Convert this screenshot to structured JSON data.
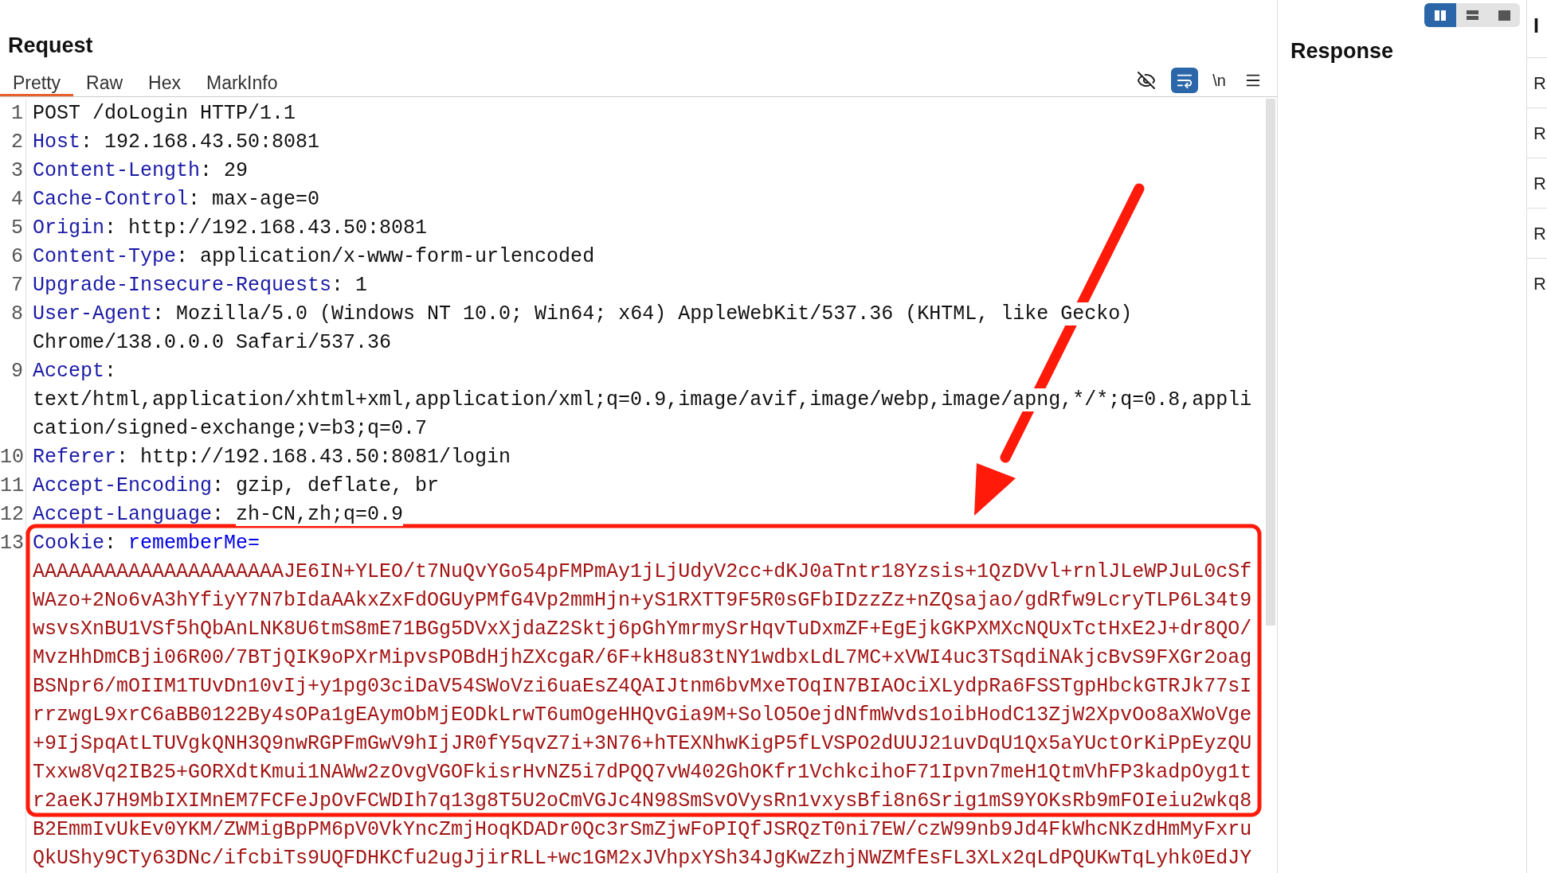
{
  "request": {
    "title": "Request",
    "tabs": [
      {
        "label": "Pretty",
        "selected": true
      },
      {
        "label": "Raw",
        "selected": false
      },
      {
        "label": "Hex",
        "selected": false
      },
      {
        "label": "MarkInfo",
        "selected": false
      }
    ],
    "toolbar": [
      {
        "kind": "hide",
        "selected": false
      },
      {
        "kind": "wrap",
        "selected": true
      },
      {
        "kind": "newline",
        "label": "\\n"
      },
      {
        "kind": "menu"
      }
    ],
    "lines": [
      {
        "number": "1",
        "kind": "request",
        "value_lines": [
          "POST /doLogin HTTP/1.1"
        ]
      },
      {
        "number": "2",
        "kind": "header",
        "name": "Host",
        "separator": ":",
        "value_lines": [
          "192.168.43.50:8081"
        ]
      },
      {
        "number": "3",
        "kind": "header",
        "name": "Content-Length",
        "separator": ":",
        "value_lines": [
          "29"
        ]
      },
      {
        "number": "4",
        "kind": "header",
        "name": "Cache-Control",
        "separator": ":",
        "value_lines": [
          "max-age=0"
        ]
      },
      {
        "number": "5",
        "kind": "header",
        "name": "Origin",
        "separator": ":",
        "value_lines": [
          "http://192.168.43.50:8081"
        ]
      },
      {
        "number": "6",
        "kind": "header",
        "name": "Content-Type",
        "separator": ":",
        "value_lines": [
          "application/x-www-form-urlencoded"
        ]
      },
      {
        "number": "7",
        "kind": "header",
        "name": "Upgrade-Insecure-Requests",
        "separator": ":",
        "value_lines": [
          "1"
        ]
      },
      {
        "number": "8",
        "kind": "header",
        "name": "User-Agent",
        "separator": ":",
        "value_lines": [
          "Mozilla/5.0 (Windows NT 10.0; Win64; x64) AppleWebKit/537.36 (KHTML, like Gecko)",
          "Chrome/138.0.0.0 Safari/537.36"
        ]
      },
      {
        "number": "9",
        "kind": "header",
        "name": "Accept",
        "separator": ":",
        "value_below": true,
        "value_lines": [
          "text/html,application/xhtml+xml,application/xml;q=0.9,image/avif,image/webp,image/apng,*/*;q=0.8,appli",
          "cation/signed-exchange;v=b3;q=0.7"
        ]
      },
      {
        "number": "10",
        "kind": "header",
        "name": "Referer",
        "separator": ":",
        "value_lines": [
          "http://192.168.43.50:8081/login"
        ]
      },
      {
        "number": "11",
        "kind": "header",
        "name": "Accept-Encoding",
        "separator": ":",
        "value_lines": [
          "gzip, deflate, br"
        ]
      },
      {
        "number": "12",
        "kind": "header",
        "name": "Accept-Language",
        "separator": ":",
        "value_lines": [
          "zh-CN,zh;q=0.9"
        ]
      },
      {
        "number": "13",
        "kind": "cookie",
        "name": "Cookie",
        "separator": ":",
        "cookie_name": "rememberMe=",
        "value_below": true,
        "value_lines": [
          "AAAAAAAAAAAAAAAAAAAAAJE6IN+YLEO/t7NuQvYGo54pFMPmAy1jLjUdyV2cc+dKJ0aTntr18Yzsis+1QzDVvl+rnlJLeWPJuL0cSf",
          "WAzo+2No6vA3hYfiyY7N7bIdaAAkxZxFdOGUyPMfG4Vp2mmHjn+yS1RXTT9F5R0sGFbIDzzZz+nZQsajao/gdRfw9LcryTLP6L34t9",
          "wsvsXnBU1VSf5hQbAnLNK8U6tmS8mE71BGg5DVxXjdaZ2Sktj6pGhYmrmySrHqvTuDxmZF+EgEjkGKPXMXcNQUxTctHxE2J+dr8QO/",
          "MvzHhDmCBji06R00/7BTjQIK9oPXrMipvsPOBdHjhZXcgaR/6F+kH8u83tNY1wdbxLdL7MC+xVWI4uc3TSqdiNAkjcBvS9FXGr2oag",
          "BSNpr6/mOIIM1TUvDn10vIj+y1pg03ciDaV54SWoVzi6uaEsZ4QAIJtnm6bvMxeTOqIN7BIAOciXLydpRa6FSSTgpHbckGTRJk77sI",
          "rrzwgL9xrC6aBB0122By4sOPa1gEAymObMjEODkLrwT6umOgeHHQvGia9M+SolO5OejdNfmWvds1oibHodC13ZjW2XpvOo8aXWoVge",
          "+9IjSpqAtLTUVgkQNH3Q9nwRGPFmGwV9hIjJR0fY5qvZ7i+3N76+hTEXNhwKigP5fLVSPO2dUUJ21uvDqU1Qx5aYUctOrKiPpEyzQU",
          "Txxw8Vq2IB25+GORXdtKmui1NAWw2zOvgVGOFkisrHvNZ5i7dPQQ7vW402GhOKfr1VchkcihoF71Ipvn7meH1QtmVhFP3kadpOyg1t",
          "r2aeKJ7H9MbIXIMnEM7FCFeJpOvFCWDIh7q13g8T5U2oCmVGJc4N98SmSvOVysRn1vxysBfi8n6Srig1mS9YOKsRb9mFOIeiu2wkq8",
          "B2EmmIvUkEv0YKM/ZWMigBpPM6pV0VkYncZmjHoqKDADr0Qc3rSmZjwFoPIQfJSRQzT0ni7EW/czW99nb9Jd4FkWhcNKzdHmMyFxru",
          "QkUShy9CTy63DNc/ifcbiTs9UQFDHKCfu2ugJjirRLL+wc1GM2xJVhpxYSh34JgKwZzhjNWZMfEsFL3XLx2qLdPQUKwTqLyhk0EdJY"
        ]
      }
    ]
  },
  "response": {
    "title": "Response",
    "layouts": [
      {
        "kind": "columns",
        "selected": true
      },
      {
        "kind": "rows",
        "selected": false
      },
      {
        "kind": "single",
        "selected": false
      }
    ]
  },
  "inspector": {
    "title": "I",
    "items": [
      "R",
      "R",
      "R",
      "R",
      "R"
    ]
  }
}
